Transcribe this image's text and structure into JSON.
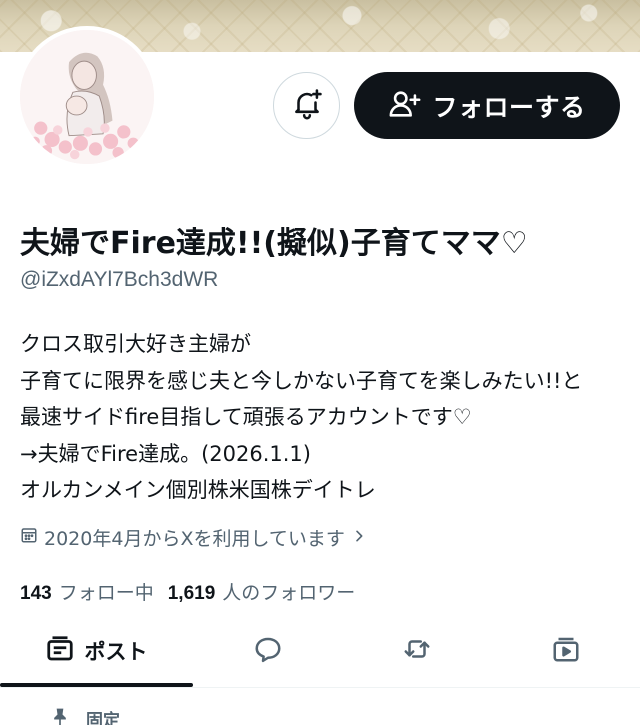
{
  "profile": {
    "display_name": "夫婦でFire達成!!(擬似)子育てママ♡",
    "handle": "@iZxdAYl7Bch3dWR",
    "bio_lines": [
      "クロス取引大好き主婦が",
      "子育てに限界を感じ夫と今しかない子育てを楽しみたい!!と",
      "最速サイドfire目指して頑張るアカウントです♡",
      "→夫婦でFire達成。(2026.1.1)",
      "オルカンメイン個別株米国株デイトレ"
    ],
    "joined": "2020年4月からXを利用しています",
    "following_count": "143",
    "following_label": "フォロー中",
    "followers_count": "1,619",
    "followers_label": "人のフォロワー"
  },
  "actions": {
    "follow_label": "フォローする"
  },
  "tabs": {
    "posts_label": "ポスト"
  },
  "pinned": {
    "label": "固定"
  },
  "icons": [
    "bell-plus-icon",
    "person-plus-icon",
    "calendar-icon",
    "chevron-right-icon",
    "posts-icon",
    "reply-icon",
    "repost-icon",
    "media-icon",
    "pin-icon"
  ],
  "colors": {
    "text": "#0f1419",
    "secondary": "#536471",
    "button": "#0f1419",
    "border": "#cfd9de"
  }
}
